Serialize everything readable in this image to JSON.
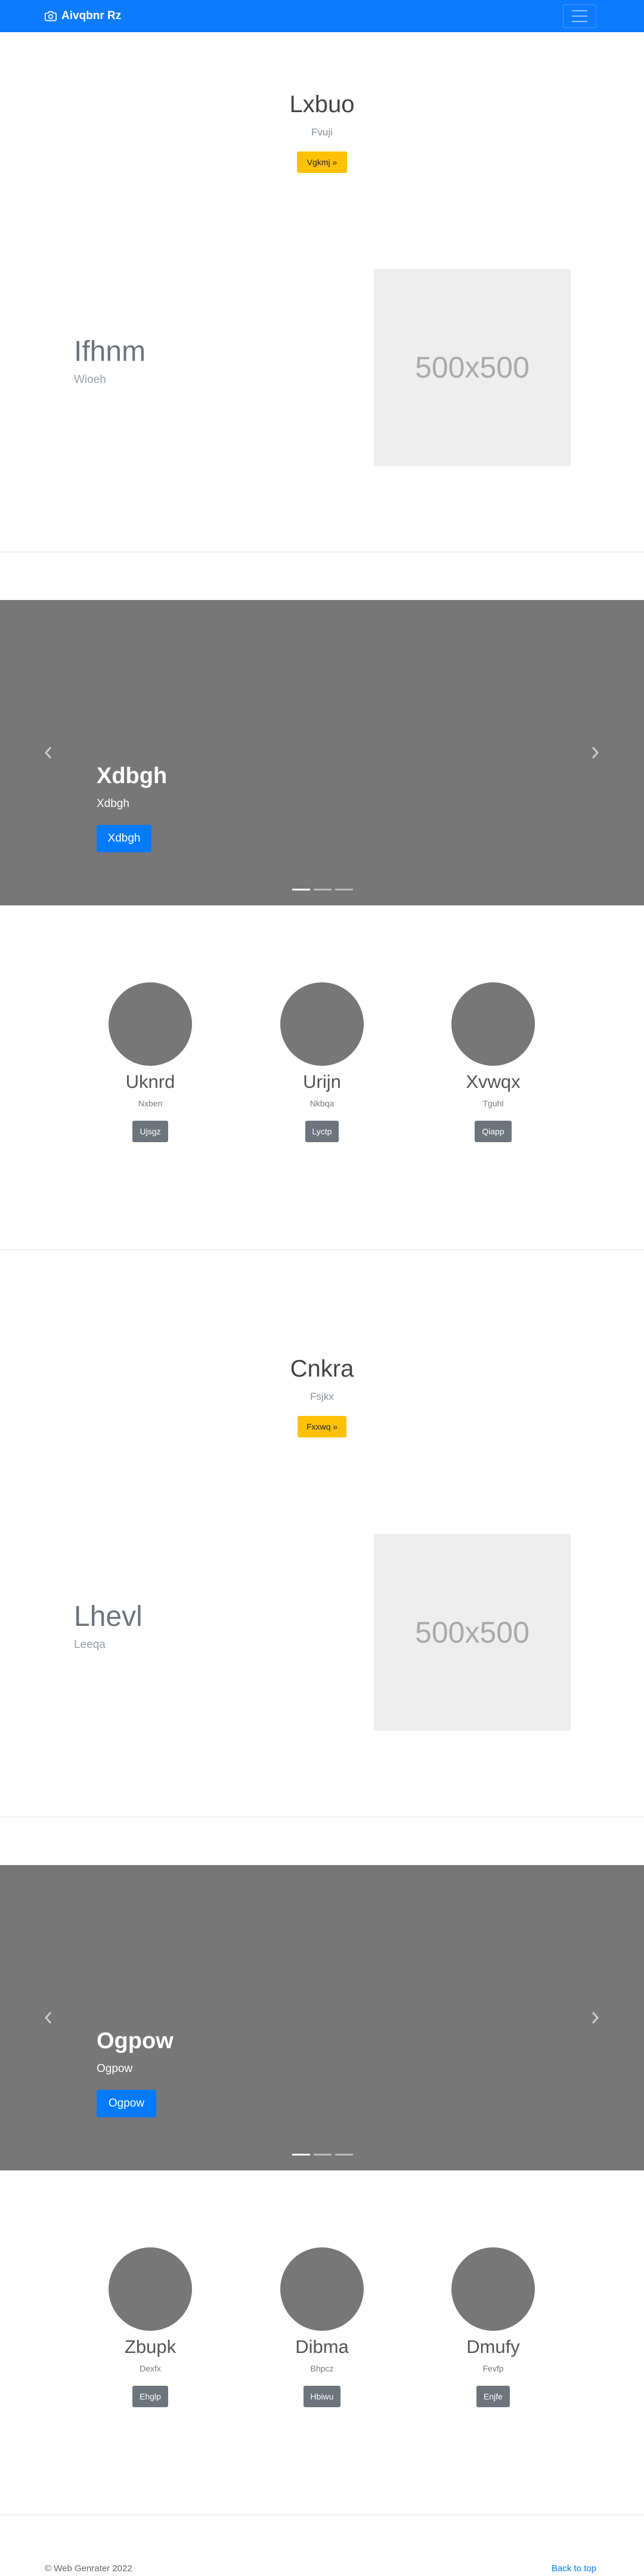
{
  "navbar": {
    "brand": "Aivqbnr Rz",
    "brand_icon": "camera-icon",
    "toggle_icon": "hamburger-icon"
  },
  "sections": [
    {
      "jumbotron": {
        "title": "Lxbuo",
        "subtitle": "Fvuji",
        "button": "Vgkmj »"
      },
      "feature": {
        "title": "Ifhnm",
        "subtitle": "Wioeh",
        "placeholder": "500x500"
      },
      "carousel": {
        "title": "Xdbgh",
        "subtitle": "Xdbgh",
        "button": "Xdbgh",
        "prev_icon": "chevron-left-icon",
        "next_icon": "chevron-right-icon"
      },
      "team": [
        {
          "name": "Uknrd",
          "sub": "Nxben",
          "button": "Ujsgz"
        },
        {
          "name": "Urijn",
          "sub": "Nkbqa",
          "button": "Lyctp"
        },
        {
          "name": "Xvwqx",
          "sub": "Tguhl",
          "button": "Qiapp"
        }
      ]
    },
    {
      "jumbotron": {
        "title": "Cnkra",
        "subtitle": "Fsjkx",
        "button": "Fxxwq »"
      },
      "feature": {
        "title": "Lhevl",
        "subtitle": "Leeqa",
        "placeholder": "500x500"
      },
      "carousel": {
        "title": "Ogpow",
        "subtitle": "Ogpow",
        "button": "Ogpow",
        "prev_icon": "chevron-left-icon",
        "next_icon": "chevron-right-icon"
      },
      "team": [
        {
          "name": "Zbupk",
          "sub": "Dexfx",
          "button": "Ehglp"
        },
        {
          "name": "Dibma",
          "sub": "Bhpcz",
          "button": "Hbiwu"
        },
        {
          "name": "Dmufy",
          "sub": "Fevfp",
          "button": "Enjfe"
        }
      ]
    }
  ],
  "footer": {
    "copyright": "© Web Genrater 2022",
    "back_to_top": "Back to top"
  },
  "colors": {
    "primary": "#007bff",
    "navbar": "#0d7bfd",
    "warning": "#ffc107",
    "secondary": "#6c757d",
    "carousel_bg": "#777777",
    "placeholder_bg": "#eeeeee"
  }
}
